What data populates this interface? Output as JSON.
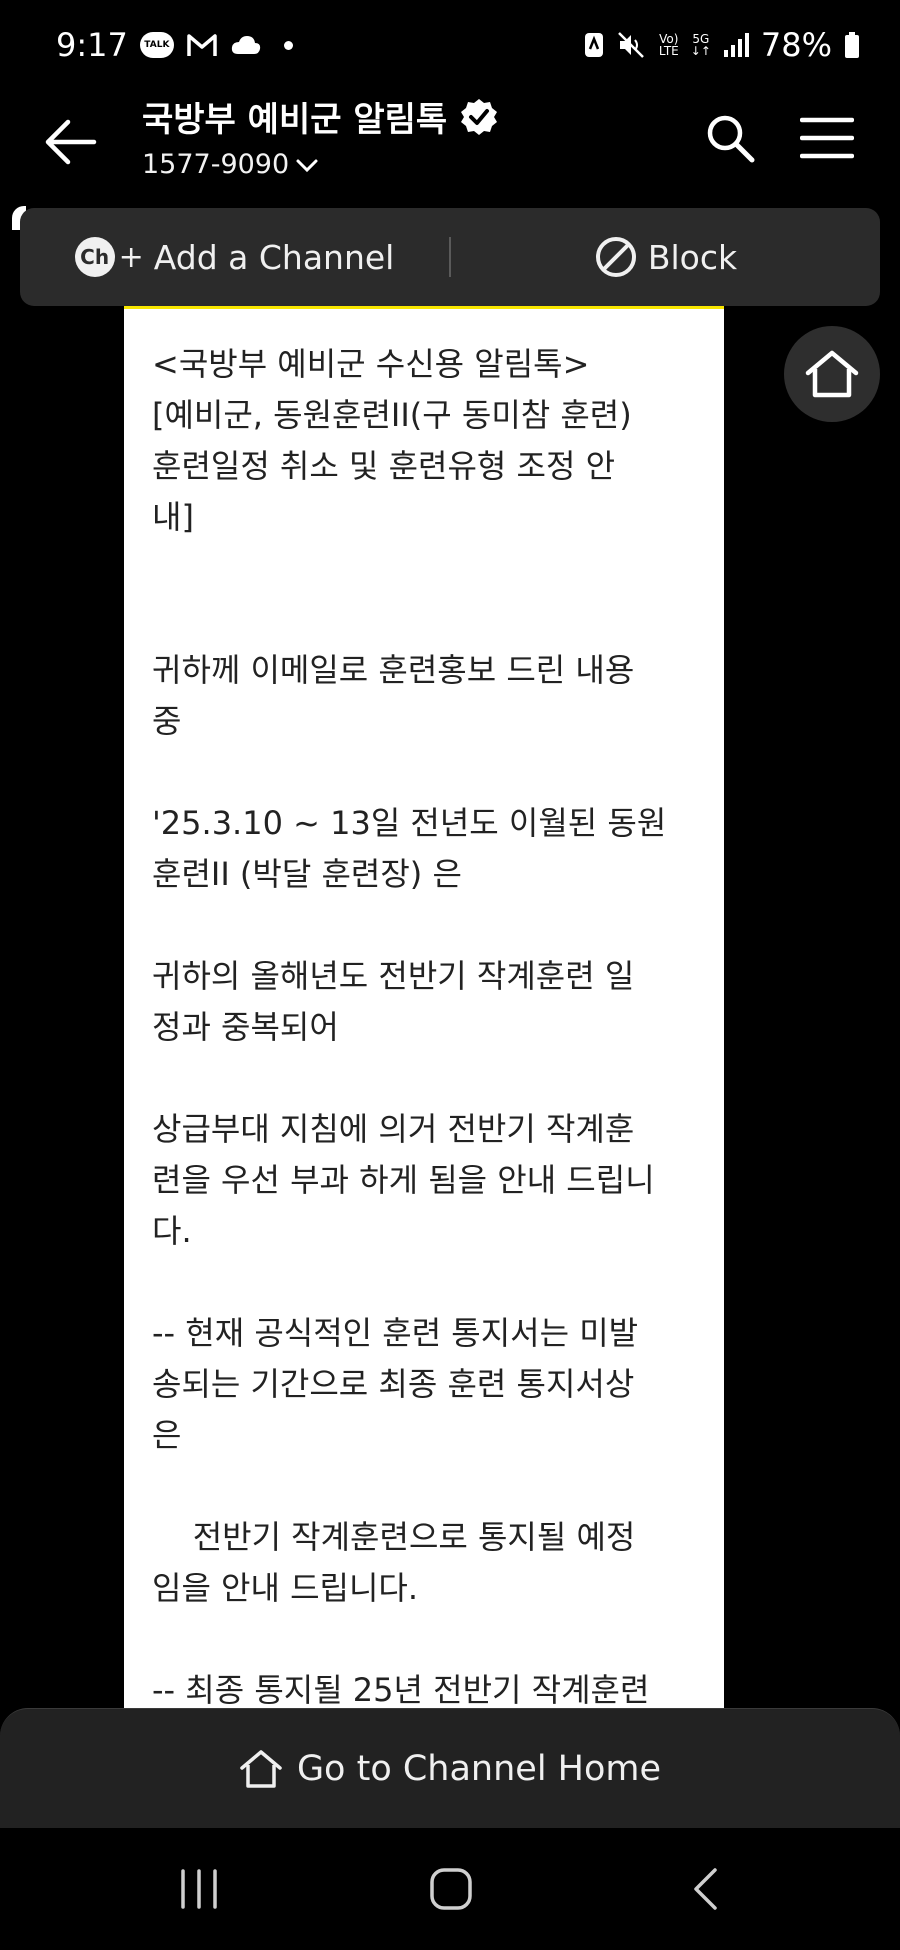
{
  "status": {
    "time": "9:17",
    "talk_label": "TALK",
    "network": "5G",
    "battery": "78%"
  },
  "header": {
    "title": "국방부 예비군 알림톡",
    "phone": "1577-9090"
  },
  "actions": {
    "add_channel_icon": "Ch",
    "add_channel": "Add a Channel",
    "block": "Block"
  },
  "message": {
    "text": "<국방부 예비군 수신용 알림톡>\n[예비군, 동원훈련II(구 동미참 훈련)\n훈련일정 취소 및 훈련유형 조정 안\n내]\n\n\n귀하께 이메일로 훈련홍보 드린 내용\n중\n\n'25.3.10 ~ 13일 전년도 이월된 동원\n훈련II (박달 훈련장) 은\n\n귀하의 올해년도 전반기 작계훈련 일\n정과 중복되어\n\n상급부대 지침에 의거 전반기 작계훈\n련을 우선 부과 하게 됨을 안내 드립니\n다.\n\n-- 현재 공식적인 훈련 통지서는 미발\n송되는 기간으로 최종 훈련 통지서상\n은\n\n    전반기 작계훈련으로 통지될 예정\n임을 안내 드립니다.\n\n-- 최종 통지될 25년 전반기 작계훈련"
  },
  "bottom": {
    "go_home": "Go to Channel Home"
  },
  "colors": {
    "background": "#000000",
    "action_bar": "#2b2b2b",
    "accent": "#f7e600",
    "bottom_bar": "#222222"
  }
}
